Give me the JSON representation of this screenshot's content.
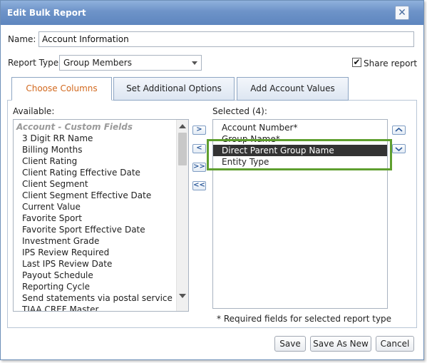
{
  "dialog": {
    "title": "Edit Bulk Report",
    "close_glyph": "✕"
  },
  "form": {
    "name_label": "Name:",
    "name_value": "Account Information",
    "report_type_label": "Report Type:",
    "report_type_value": "Group Members",
    "share_label": "Share report",
    "share_checked": true,
    "share_check_glyph": "✔"
  },
  "tabs": [
    {
      "label": "Choose Columns",
      "active": true
    },
    {
      "label": "Set Additional Options",
      "active": false
    },
    {
      "label": "Add Account Values",
      "active": false
    }
  ],
  "available": {
    "label": "Available:",
    "items": [
      {
        "text": "Account - Custom Fields",
        "group": true
      },
      {
        "text": "3 Digit RR Name"
      },
      {
        "text": "Billing Months"
      },
      {
        "text": "Client Rating"
      },
      {
        "text": "Client Rating Effective Date"
      },
      {
        "text": "Client Segment"
      },
      {
        "text": "Client Segment Effective Date"
      },
      {
        "text": "Current Value"
      },
      {
        "text": "Favorite Sport"
      },
      {
        "text": "Favorite Sport Effective Date"
      },
      {
        "text": "Investment Grade"
      },
      {
        "text": "IPS Review Required"
      },
      {
        "text": "Last IPS Review Date"
      },
      {
        "text": "Payout Schedule"
      },
      {
        "text": "Reporting Cycle"
      },
      {
        "text": "Send statements via postal service"
      },
      {
        "text": "TIAA CREF Master"
      }
    ]
  },
  "selected": {
    "label": "Selected (4):",
    "items": [
      {
        "text": "Account Number*"
      },
      {
        "text": "Group Name*"
      },
      {
        "text": "Direct Parent Group Name",
        "selected": true
      },
      {
        "text": "Entity Type"
      }
    ]
  },
  "move_buttons": {
    "add_one": ">",
    "remove_one": "<",
    "add_all": ">>",
    "remove_all": "<<"
  },
  "order_buttons": {
    "move_up": "^",
    "move_down": "v"
  },
  "required_note": "* Required fields for selected report type",
  "footer": {
    "save": "Save",
    "save_as_new": "Save As New",
    "cancel": "Cancel"
  },
  "colors": {
    "titlebar": "#6d93c8",
    "active_tab_text": "#d2691e",
    "highlight_border": "#5f9f2f",
    "selected_row": "#333333"
  },
  "icons": {
    "close": "close-icon",
    "dropdown": "chevron-down-icon",
    "move_up": "chevron-up-icon",
    "move_down": "chevron-down-icon"
  }
}
